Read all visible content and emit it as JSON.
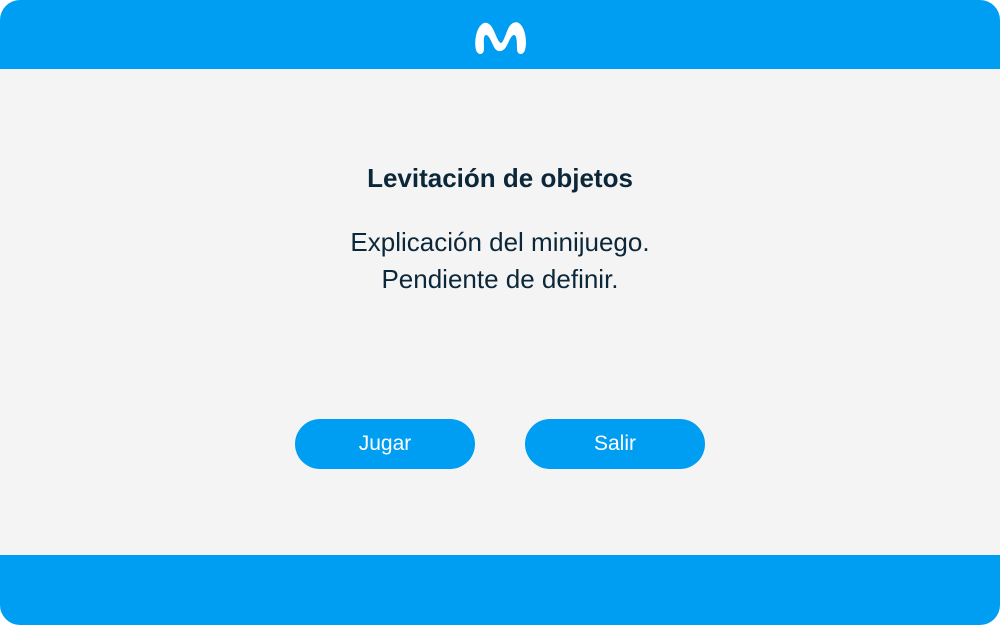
{
  "brand": {
    "logo_icon": "movistar-m-logo-icon",
    "primary_color": "#009EF2",
    "background_color": "#F4F4F4",
    "text_color": "#0B2739"
  },
  "content": {
    "title": "Levitación de objetos",
    "description_line1": "Explicación del minijuego.",
    "description_line2": "Pendiente de definir."
  },
  "actions": {
    "play_label": "Jugar",
    "exit_label": "Salir"
  }
}
